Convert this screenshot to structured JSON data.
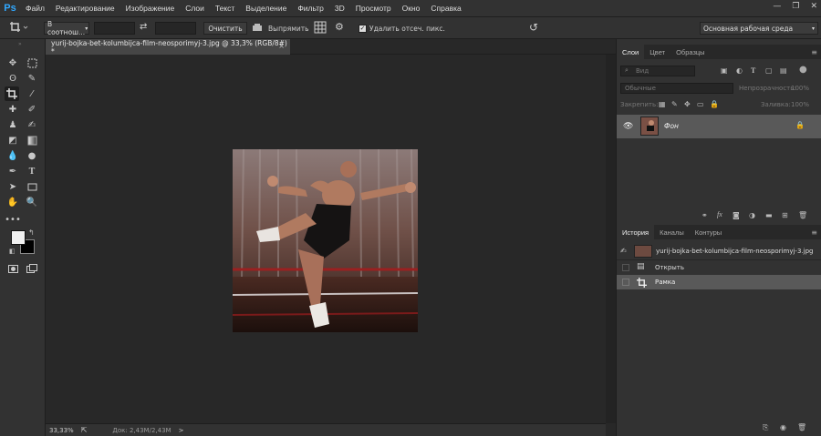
{
  "menu": {
    "logo": "Ps",
    "items": [
      "Файл",
      "Редактирование",
      "Изображение",
      "Слои",
      "Текст",
      "Выделение",
      "Фильтр",
      "3D",
      "Просмотр",
      "Окно",
      "Справка"
    ]
  },
  "window_controls": {
    "minimize": "—",
    "restore": "❐",
    "close": "✕"
  },
  "options_bar": {
    "ratio_dropdown": "В соотнош...",
    "clear_button": "Очистить",
    "straighten_label": "Выпрямить",
    "delete_pixels_checkbox": {
      "label": "Удалить отсеч. пикс.",
      "checked": true
    },
    "workspace_dropdown": "Основная рабочая среда"
  },
  "document": {
    "tab_title": "yurij-bojka-bet-kolumbijca-film-neosporimyj-3.jpg @ 33,3% (RGB/8#) *",
    "close_glyph": "×"
  },
  "status_bar": {
    "zoom": "33,33%",
    "doc_info": "Док: 2,43M/2,43M",
    "arrow": ">"
  },
  "layers_panel": {
    "tabs": [
      "Слои",
      "Цвет",
      "Образцы"
    ],
    "active_tab": "Слои",
    "filter_placeholder": "Вид",
    "blend_mode": "Обычные",
    "opacity_label": "Непрозрачность:",
    "opacity_value": "100%",
    "lock_label": "Закрепить:",
    "fill_label": "Заливка:",
    "fill_value": "100%",
    "layers": [
      {
        "name": "Фон",
        "visible": true,
        "locked": true
      }
    ]
  },
  "history_panel": {
    "tabs": [
      "История",
      "Каналы",
      "Контуры"
    ],
    "active_tab": "История",
    "snapshot": "yurij-bojka-bet-kolumbijca-film-neosporimyj-3.jpg",
    "steps": [
      {
        "name": "Открыть",
        "icon": "document-icon",
        "selected": false
      },
      {
        "name": "Рамка",
        "icon": "crop-icon",
        "selected": true
      }
    ]
  },
  "colors": {
    "accent": "#31a8ff",
    "foreground_swatch": "#f0f0f0",
    "background_swatch": "#000000"
  }
}
